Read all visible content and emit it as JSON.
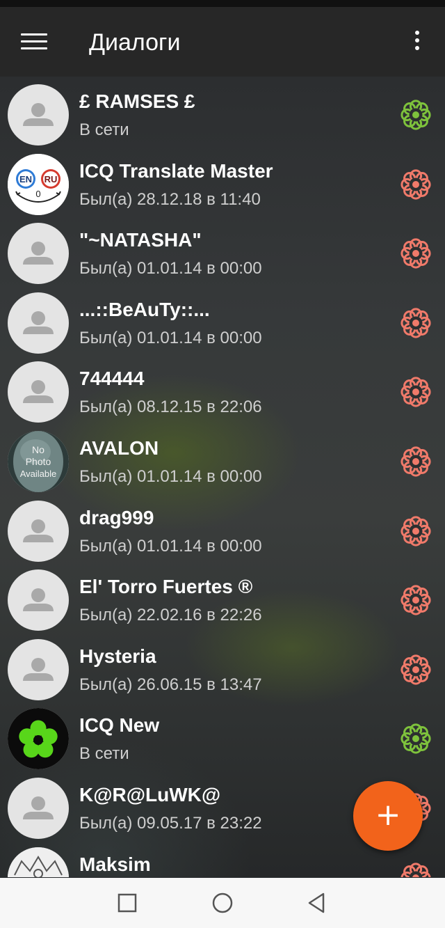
{
  "appbar": {
    "title": "Диалоги",
    "menu_icon": "hamburger-menu-icon",
    "overflow_icon": "more-vertical-icon"
  },
  "colors": {
    "online": "#7ec23c",
    "offline": "#f07a6a",
    "fab": "#f2631b",
    "appbar": "#272727"
  },
  "contacts": [
    {
      "name": "£ RAMSES £",
      "status": "В сети",
      "online": true,
      "avatar": "default"
    },
    {
      "name": "ICQ Translate Master",
      "status": "Был(а) 28.12.18 в 11:40",
      "online": false,
      "avatar": "translate",
      "avatar_labels": [
        "EN",
        "RU",
        "0"
      ]
    },
    {
      "name": "\"~NATASHA\"",
      "status": "Был(а) 01.01.14 в 00:00",
      "online": false,
      "avatar": "default"
    },
    {
      "name": "...::BeAuTy::...",
      "status": "Был(а) 01.01.14 в 00:00",
      "online": false,
      "avatar": "default"
    },
    {
      "name": "744444",
      "status": "Был(а) 08.12.15 в 22:06",
      "online": false,
      "avatar": "default"
    },
    {
      "name": "AVALON",
      "status": "Был(а) 01.01.14 в 00:00",
      "online": false,
      "avatar": "nophoto",
      "avatar_labels": [
        "No",
        "Photo",
        "Available"
      ]
    },
    {
      "name": "drag999",
      "status": "Был(а) 01.01.14 в 00:00",
      "online": false,
      "avatar": "default"
    },
    {
      "name": "El' Torro Fuertes ®",
      "status": "Был(а) 22.02.16 в 22:26",
      "online": false,
      "avatar": "default"
    },
    {
      "name": "Hysteria",
      "status": "Был(а) 26.06.15 в 13:47",
      "online": false,
      "avatar": "default"
    },
    {
      "name": "ICQ New",
      "status": "В сети",
      "online": true,
      "avatar": "icq"
    },
    {
      "name": "K@R@LuWK@",
      "status": "Был(а) 09.05.17 в 23:22",
      "online": false,
      "avatar": "default"
    },
    {
      "name": "Maksim",
      "status": "",
      "online": false,
      "avatar": "sketch"
    }
  ],
  "fab": {
    "label": "+",
    "icon": "add-icon"
  },
  "navbar": {
    "icons": [
      "recents-square-icon",
      "home-circle-icon",
      "back-triangle-icon"
    ]
  }
}
